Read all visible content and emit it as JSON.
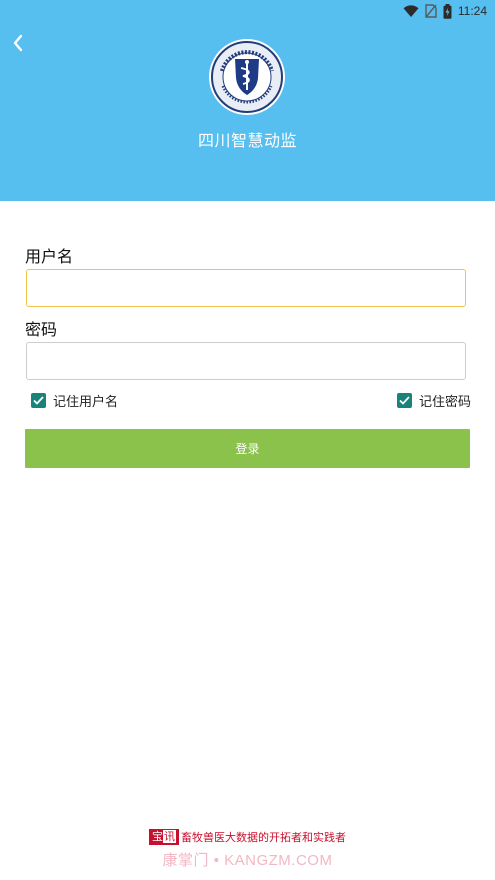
{
  "status_bar": {
    "time": "11:24"
  },
  "header": {
    "background_color": "#56bff0",
    "back_icon": "chevron-left-icon",
    "logo_icon": "health-emblem-icon",
    "title": "四川智慧动监"
  },
  "form": {
    "username_label": "用户名",
    "username_value": "",
    "password_label": "密码",
    "password_value": "",
    "remember_username_label": "记住用户名",
    "remember_username_checked": true,
    "remember_password_label": "记住密码",
    "remember_password_checked": true,
    "login_label": "登录",
    "login_color": "#8bc24c",
    "checkbox_color": "#17837a"
  },
  "footer": {
    "badge_left": "宝",
    "badge_right": "讯",
    "slogan": "畜牧兽医大数据的开拓者和实践者",
    "watermark": "康掌门 • KANGZM.COM"
  }
}
